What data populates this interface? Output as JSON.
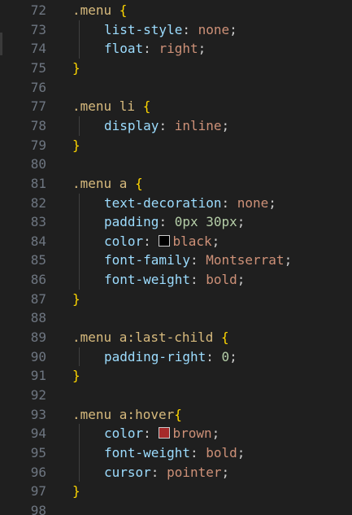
{
  "editor": {
    "lines": [
      {
        "n": "72",
        "t": ".menu {"
      },
      {
        "n": "73",
        "t": "list-style: none;"
      },
      {
        "n": "74",
        "t": "float: right;"
      },
      {
        "n": "75",
        "t": "}"
      },
      {
        "n": "76",
        "t": ""
      },
      {
        "n": "77",
        "t": ".menu li {"
      },
      {
        "n": "78",
        "t": "display: inline;"
      },
      {
        "n": "79",
        "t": "}"
      },
      {
        "n": "80",
        "t": ""
      },
      {
        "n": "81",
        "t": ".menu a {"
      },
      {
        "n": "82",
        "t": "text-decoration: none;"
      },
      {
        "n": "83",
        "t": "padding: 0px 30px;"
      },
      {
        "n": "84",
        "t": "color: black;"
      },
      {
        "n": "85",
        "t": "font-family: Montserrat;"
      },
      {
        "n": "86",
        "t": "font-weight: bold;"
      },
      {
        "n": "87",
        "t": "}"
      },
      {
        "n": "88",
        "t": ""
      },
      {
        "n": "89",
        "t": ".menu a:last-child {"
      },
      {
        "n": "90",
        "t": "padding-right: 0;"
      },
      {
        "n": "91",
        "t": "}"
      },
      {
        "n": "92",
        "t": ""
      },
      {
        "n": "93",
        "t": ".menu a:hover{"
      },
      {
        "n": "94",
        "t": "color: brown;"
      },
      {
        "n": "95",
        "t": "font-weight: bold;"
      },
      {
        "n": "96",
        "t": "cursor: pointer;"
      },
      {
        "n": "97",
        "t": "}"
      },
      {
        "n": "98",
        "t": ""
      }
    ],
    "swatches": {
      "black": "#000000",
      "brown": "#a52a2a"
    }
  },
  "colors": {
    "background": "#1f1f1f",
    "line_number": "#6e7681",
    "selector": "#d7ba7d",
    "bracket": "#ffd700",
    "property": "#9cdcfe",
    "value": "#ce9178",
    "number": "#b5cea8"
  }
}
